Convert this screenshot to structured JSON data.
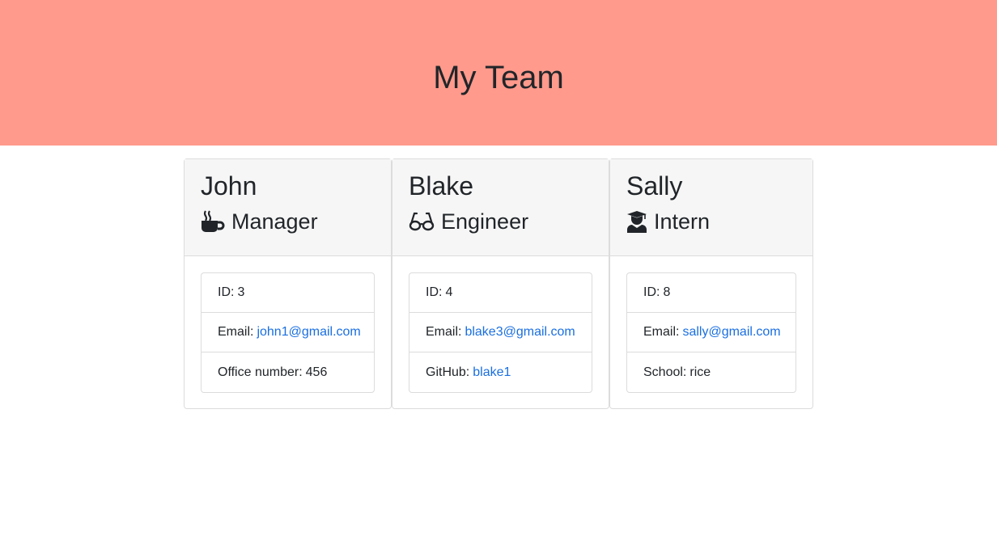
{
  "header": {
    "title": "My Team"
  },
  "team": [
    {
      "name": "John",
      "role": "Manager",
      "role_icon": "coffee-mug-icon",
      "id_label": "ID:",
      "id": "3",
      "email_label": "Email:",
      "email": "john1@gmail.com",
      "extra_label": "Office number:",
      "extra_value": "456"
    },
    {
      "name": "Blake",
      "role": "Engineer",
      "role_icon": "glasses-icon",
      "id_label": "ID:",
      "id": "4",
      "email_label": "Email:",
      "email": "blake3@gmail.com",
      "extra_label": "GitHub:",
      "extra_value": "blake1"
    },
    {
      "name": "Sally",
      "role": "Intern",
      "role_icon": "graduate-icon",
      "id_label": "ID:",
      "id": "8",
      "email_label": "Email:",
      "email": "sally@gmail.com",
      "extra_label": "School:",
      "extra_value": "rice"
    }
  ],
  "colors": {
    "header_bg": "#ff9a8c",
    "link": "#1a6fe0",
    "card_header_bg": "#f6f6f6"
  }
}
